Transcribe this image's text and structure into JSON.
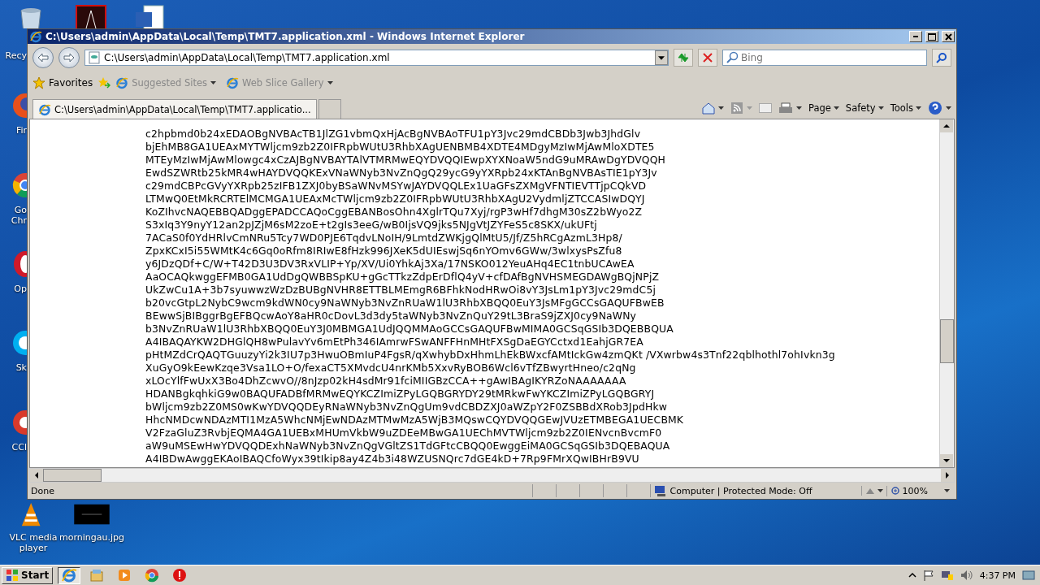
{
  "desktop_icons": [
    {
      "kind": "recycle",
      "label": "Recy"
    },
    {
      "kind": "pdf"
    },
    {
      "kind": "word"
    },
    {
      "kind": "firefox",
      "label": "Fir"
    },
    {
      "kind": "chrome",
      "label": "Go\nChr"
    },
    {
      "kind": "opera",
      "label": "Op"
    },
    {
      "kind": "skype",
      "label": "Sk"
    },
    {
      "kind": "ccleaner",
      "label": "CCl"
    },
    {
      "kind": "vlc",
      "label": "VLC media\nplayer"
    },
    {
      "kind": "image",
      "label": "morningau.jpg"
    }
  ],
  "window": {
    "title": "C:\\Users\\admin\\AppData\\Local\\Temp\\TMT7.application.xml - Windows Internet Explorer"
  },
  "address": {
    "value": "C:\\Users\\admin\\AppData\\Local\\Temp\\TMT7.application.xml"
  },
  "search": {
    "placeholder": "Bing"
  },
  "favorites_bar": {
    "label": "Favorites",
    "links": [
      "Suggested Sites",
      "Web Slice Gallery"
    ]
  },
  "tabs": [
    {
      "label": "C:\\Users\\admin\\AppData\\Local\\Temp\\TMT7.applicatio...",
      "selected": true
    },
    {
      "selected": false
    }
  ],
  "command_bar": [
    "Page",
    "Safety",
    "Tools"
  ],
  "content_lines": [
    "c2hpbmd0b24xEDAOBgNVBAcTB1JlZG1vbmQxHjAcBgNVBAoTFU1pY3Jvc29mdCBDb3Jwb3JhdGlv",
    "bjEhMB8GA1UEAxMYTWljcm9zb2Z0IFRpbWUtU3RhbXAgUENBMB4XDTE4MDgyMzIwMjAwMloXDTE5",
    "MTEyMzIwMjAwMlowgc4xCzAJBgNVBAYTAlVTMRMwEQYDVQQIEwpXYXNoaW5ndG9uMRAwDgYDVQQH",
    "EwdSZWRtb25kMR4wHAYDVQQKExVNaWNyb3NvZnQgQ29ycG9yYXRpb24xKTAnBgNVBAsTIE1pY3Jv",
    "c29mdCBPcGVyYXRpb25zIFB1ZXJ0byBSaWNvMSYwJAYDVQQLEx1UaGFsZXMgVFNTIEVTTjpCQkVD",
    "LTMwQ0EtMkRCRTElMCMGA1UEAxMcTWljcm9zb2Z0IFRpbWUtU3RhbXAgU2VydmljZTCCASIwDQYJ",
    "KoZIhvcNAQEBBQADggEPADCCAQoCggEBANBosOhn4XglrTQu7Xyj/rgP3wHf7dhgM30sZ2bWyo2Z",
    "S3xIq3Y9nyY12an2pJZjM6sM2zoE+t2gIs3eeG/wB0IjsVQ9jks5NJgVtJZYFeS5c8SKX/ukUFtj",
    "7ACaS0f0YdHRlvCmNRu5Tcy7WD0PJE6TqdvLNoIH/9LmtdZWKjgQlMtU5/Jf/Z5hRCgAzmL3Hp8/",
    "ZpxKCxI5i55WMtK4c6Gq0oRfm8IRIwE8fHzk996JXeK5dUIEswjSq6nYOmv6GWw/3wlxysPsZfu8",
    "y6JDzQDf+C/W+T42D3U3DV3RxVLIP+Yp/XV/Ui0YhkAj3Xa/17NSKO012YeuAHq4EC1tnbUCAwEA",
    "AaOCAQkwggEFMB0GA1UdDgQWBBSpKU+gGcTTkzZdpErDflQ4yV+cfDAfBgNVHSMEGDAWgBQjNPjZ",
    "UkZwCu1A+3b7syuwwzWzDzBUBgNVHR8ETTBLMEmgR6BFhkNodHRwOi8vY3JsLm1pY3Jvc29mdC5j",
    "b20vcGtpL2NybC9wcm9kdWN0cy9NaWNyb3NvZnRUaW1lU3RhbXBQQ0EuY3JsMFgGCCsGAQUFBwEB",
    "BEwwSjBIBggrBgEFBQcwAoY8aHR0cDovL3d3dy5taWNyb3NvZnQuY29tL3BraS9jZXJ0cy9NaWNy",
    "b3NvZnRUaW1lU3RhbXBQQ0EuY3J0MBMGA1UdJQQMMAoGCCsGAQUFBwMIMA0GCSqGSIb3DQEBBQUA",
    "A4IBAQAYKW2DHGlQH8wPulavYv6mEtPh346IAmrwFSwANFFHnMHtFXSgDaEGYCctxd1EahjGR7EA",
    "pHtMZdCrQAQTGuuzyYi2k3IU7p3HwuOBmIuP4FgsR/qXwhybDxHhmLhEkBWxcfAMtIckGw4zmQKt /VXwrbw4s3Tnf22qblhothl7ohIvkn3g",
    "XuGyO9kEewKzqe3Vsa1LO+O/fexaCT5XMvdcU4nrKMb5XxvRyBOB6Wcl6vTfZBwyrtHneo/c2qNg",
    "xLOcYlfFwUxX3Bo4DhZcwvO//8nJzp02kH4sdMr91fciMIIGBzCCA++gAwIBAgIKYRZoNAAAAAAA",
    "HDANBgkqhkiG9w0BAQUFADBfMRMwEQYKCZImiZPyLGQBGRYDY29tMRkwFwYKCZImiZPyLGQBGRYJ",
    "bWljcm9zb2Z0MS0wKwYDVQQDEyRNaWNyb3NvZnQgUm9vdCBDZXJ0aWZpY2F0ZSBBdXRob3JpdHkw",
    "HhcNMDcwNDAzMTI1MzA5WhcNMjEwNDAzMTMwMzA5WjB3MQswCQYDVQQGEwJVUzETMBEGA1UECBMK",
    "V2FzaGluZ3RvbjEQMA4GA1UEBxMHUmVkbW9uZDEeMBwGA1UEChMVTWljcm9zb2Z0IENvcnBvcmF0",
    "aW9uMSEwHwYDVQQDExhNaWNyb3NvZnQgVGltZS1TdGFtcCBQQ0EwggEiMA0GCSqGSIb3DQEBAQUA",
    "A4IBDwAwggEKAoIBAQCfoWyx39tIkip8ay4Z4b3i48WZUSNQrc7dGE4kD+7Rp9FMrXQwIBHrB9VU"
  ],
  "status_bar": {
    "text": "Done",
    "zone": "Computer | Protected Mode: Off",
    "zoom": "100%"
  },
  "taskbar": {
    "start": "Start",
    "apps": [
      {
        "kind": "ie",
        "selected": true
      },
      {
        "kind": "explorer",
        "selected": false
      },
      {
        "kind": "media",
        "selected": false
      },
      {
        "kind": "chrome",
        "selected": false
      },
      {
        "kind": "stop",
        "selected": false
      }
    ],
    "time": "4:37 PM"
  }
}
